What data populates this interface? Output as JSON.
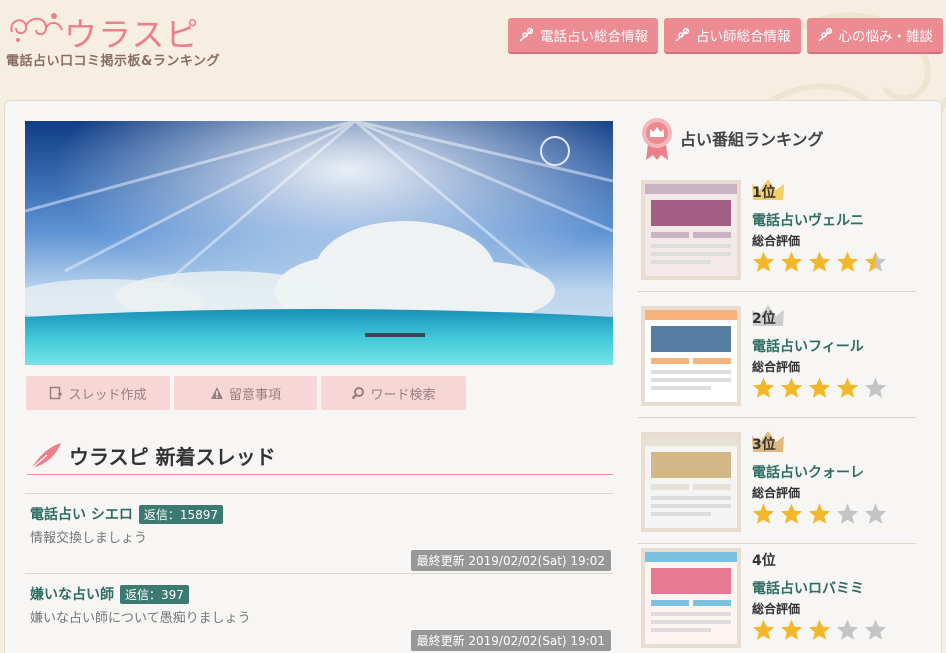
{
  "header": {
    "logo_title": "ウラスピ",
    "logo_subtitle": "電話占い口コミ掲示板&ランキング",
    "nav": [
      {
        "label": "電話占い総合情報"
      },
      {
        "label": "占い師総合情報"
      },
      {
        "label": "心の悩み・雑談"
      }
    ]
  },
  "tools": [
    {
      "label": "スレッド作成",
      "icon": "create-thread-icon"
    },
    {
      "label": "留意事項",
      "icon": "warning-icon"
    },
    {
      "label": "ワード検索",
      "icon": "search-icon"
    }
  ],
  "section": {
    "title": "ウラスピ 新着スレッド"
  },
  "threads": [
    {
      "name": "電話占い シエロ",
      "replies": "返信：15897",
      "desc": "情報交換しましょう",
      "updated": "最終更新 2019/02/02(Sat) 19:02"
    },
    {
      "name": "嫌いな占い師",
      "replies": "返信：397",
      "desc": "嫌いな占い師について愚痴りましょう",
      "updated": "最終更新 2019/02/02(Sat) 19:01"
    }
  ],
  "ranking": {
    "title": "占い番組ランキング",
    "label": "総合評価",
    "items": [
      {
        "position": "1位",
        "name": "電話占いヴェルニ",
        "rating": 4.5,
        "crown": "#f0c23a"
      },
      {
        "position": "2位",
        "name": "電話占いフィール",
        "rating": 4,
        "crown": "#c0c0c0"
      },
      {
        "position": "3位",
        "name": "電話占いクォーレ",
        "rating": 3,
        "crown": "#d9a45a"
      },
      {
        "position": "4位",
        "name": "電話占いロバミミ",
        "rating": 3,
        "crown": ""
      }
    ]
  },
  "colors": {
    "accent": "#ed8b93",
    "teal": "#2d6e63",
    "star": "#f3b82a",
    "star_off": "#c4c4c4"
  }
}
